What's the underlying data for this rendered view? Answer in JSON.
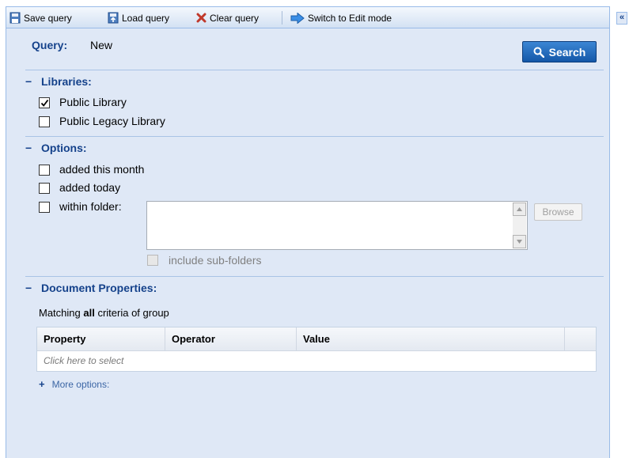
{
  "toolbar": {
    "save_label": "Save query",
    "load_label": "Load query",
    "clear_label": "Clear query",
    "edit_mode_label": "Switch to Edit mode",
    "collapse_label": "«"
  },
  "query": {
    "label": "Query:",
    "value": "New",
    "search_label": "Search"
  },
  "libraries": {
    "title": "Libraries:",
    "items": [
      {
        "label": "Public Library",
        "checked": true
      },
      {
        "label": "Public Legacy Library",
        "checked": false
      }
    ]
  },
  "options": {
    "title": "Options:",
    "added_month": "added this month",
    "added_today": "added today",
    "within_folder": "within folder:",
    "browse_label": "Browse",
    "include_sub": "include sub-folders"
  },
  "doc_props": {
    "title": "Document Properties:",
    "matching_pre": "Matching ",
    "matching_bold": "all",
    "matching_post": " criteria of group",
    "columns": [
      "Property",
      "Operator",
      "Value"
    ],
    "placeholder_row": "Click here to select",
    "more_options": "More options:"
  },
  "colors": {
    "accent": "#15428b",
    "search_button": "#1e66bd",
    "panel_bg": "#dfe8f6",
    "clear_icon": "#c0392b"
  },
  "icons": [
    "save-icon",
    "load-icon",
    "clear-icon",
    "arrow-right-icon",
    "search-icon",
    "check-icon"
  ]
}
